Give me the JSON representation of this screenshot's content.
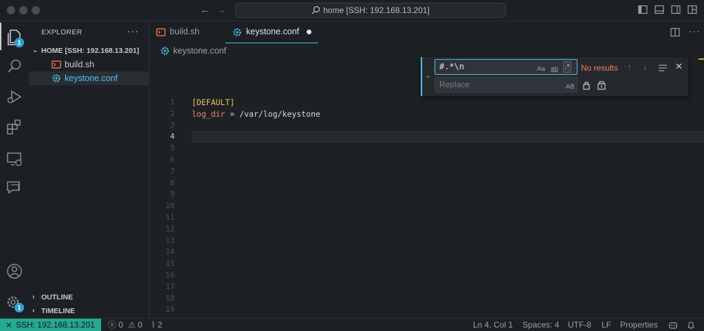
{
  "window": {
    "title": "home [SSH: 192.168.13.201]",
    "nav_back": "←",
    "nav_forward": "→"
  },
  "activity_bar": {
    "explorer_badge": "1",
    "settings_badge": "1"
  },
  "sidebar": {
    "title": "EXPLORER",
    "more": "···",
    "root": "HOME [SSH: 192.168.13.201]",
    "files": [
      {
        "name": "build.sh"
      },
      {
        "name": "keystone.conf"
      }
    ],
    "outline": "OUTLINE",
    "timeline": "TIMELINE"
  },
  "tabs": [
    {
      "label": "build.sh"
    },
    {
      "label": "keystone.conf"
    }
  ],
  "breadcrumb": "keystone.conf",
  "editor": {
    "line_numbers": [
      "1",
      "2",
      "3",
      "4",
      "5",
      "6",
      "7",
      "8",
      "9",
      "10",
      "11",
      "12",
      "13",
      "14",
      "15",
      "16",
      "17",
      "18",
      "19"
    ],
    "line1": "[DEFAULT]",
    "line2_key": "log_dir",
    "line2_eq": " = ",
    "line2_val": "/var/log/keystone"
  },
  "find": {
    "query": "#.*\\n",
    "replace_placeholder": "Replace",
    "match_case": "Aa",
    "whole_word": "ab",
    "regex": ".*",
    "preserve_case": "AB",
    "status": "No results"
  },
  "status_bar": {
    "remote": "SSH: 192.168.13.201",
    "errors": "0",
    "warnings": "0",
    "ports": "2",
    "position": "Ln 4, Col 1",
    "spaces": "Spaces: 4",
    "encoding": "UTF-8",
    "eol": "LF",
    "language": "Properties"
  },
  "colors": {
    "accent": "#4fc1e9",
    "remote_bg": "#26a891",
    "no_results": "#f47a6a",
    "ini_section": "#e8c45a",
    "ini_key": "#e8826a"
  }
}
